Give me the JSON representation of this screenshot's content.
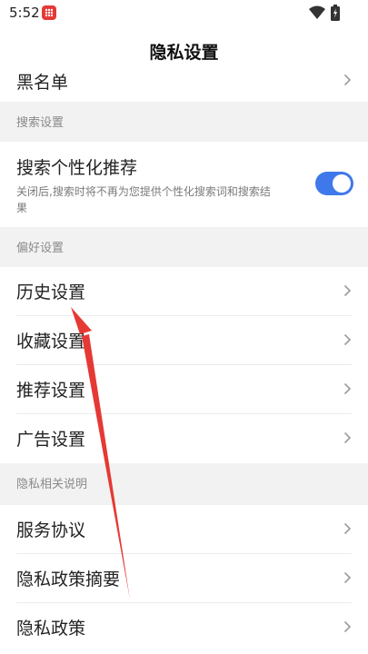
{
  "status_bar": {
    "time": "5:52",
    "app_icon": "app-grid-icon",
    "wifi_icon": "wifi-icon",
    "battery_icon": "battery-icon"
  },
  "header": {
    "title": "隐私设置"
  },
  "rows_top": {
    "blacklist_label": "黑名单"
  },
  "sections": {
    "search": {
      "header": "搜索设置",
      "personalized": {
        "title": "搜索个性化推荐",
        "description": "关闭后,搜索时将不再为您提供个性化搜索词和搜索结果",
        "enabled": true
      }
    },
    "preferences": {
      "header": "偏好设置",
      "items": [
        {
          "label": "历史设置"
        },
        {
          "label": "收藏设置"
        },
        {
          "label": "推荐设置"
        },
        {
          "label": "广告设置"
        }
      ]
    },
    "privacy": {
      "header": "隐私相关说明",
      "items": [
        {
          "label": "服务协议"
        },
        {
          "label": "隐私政策摘要"
        },
        {
          "label": "隐私政策"
        }
      ]
    }
  },
  "colors": {
    "accent": "#3f78ea",
    "annotation_arrow": "#e53935",
    "background": "#f2f2f2"
  }
}
